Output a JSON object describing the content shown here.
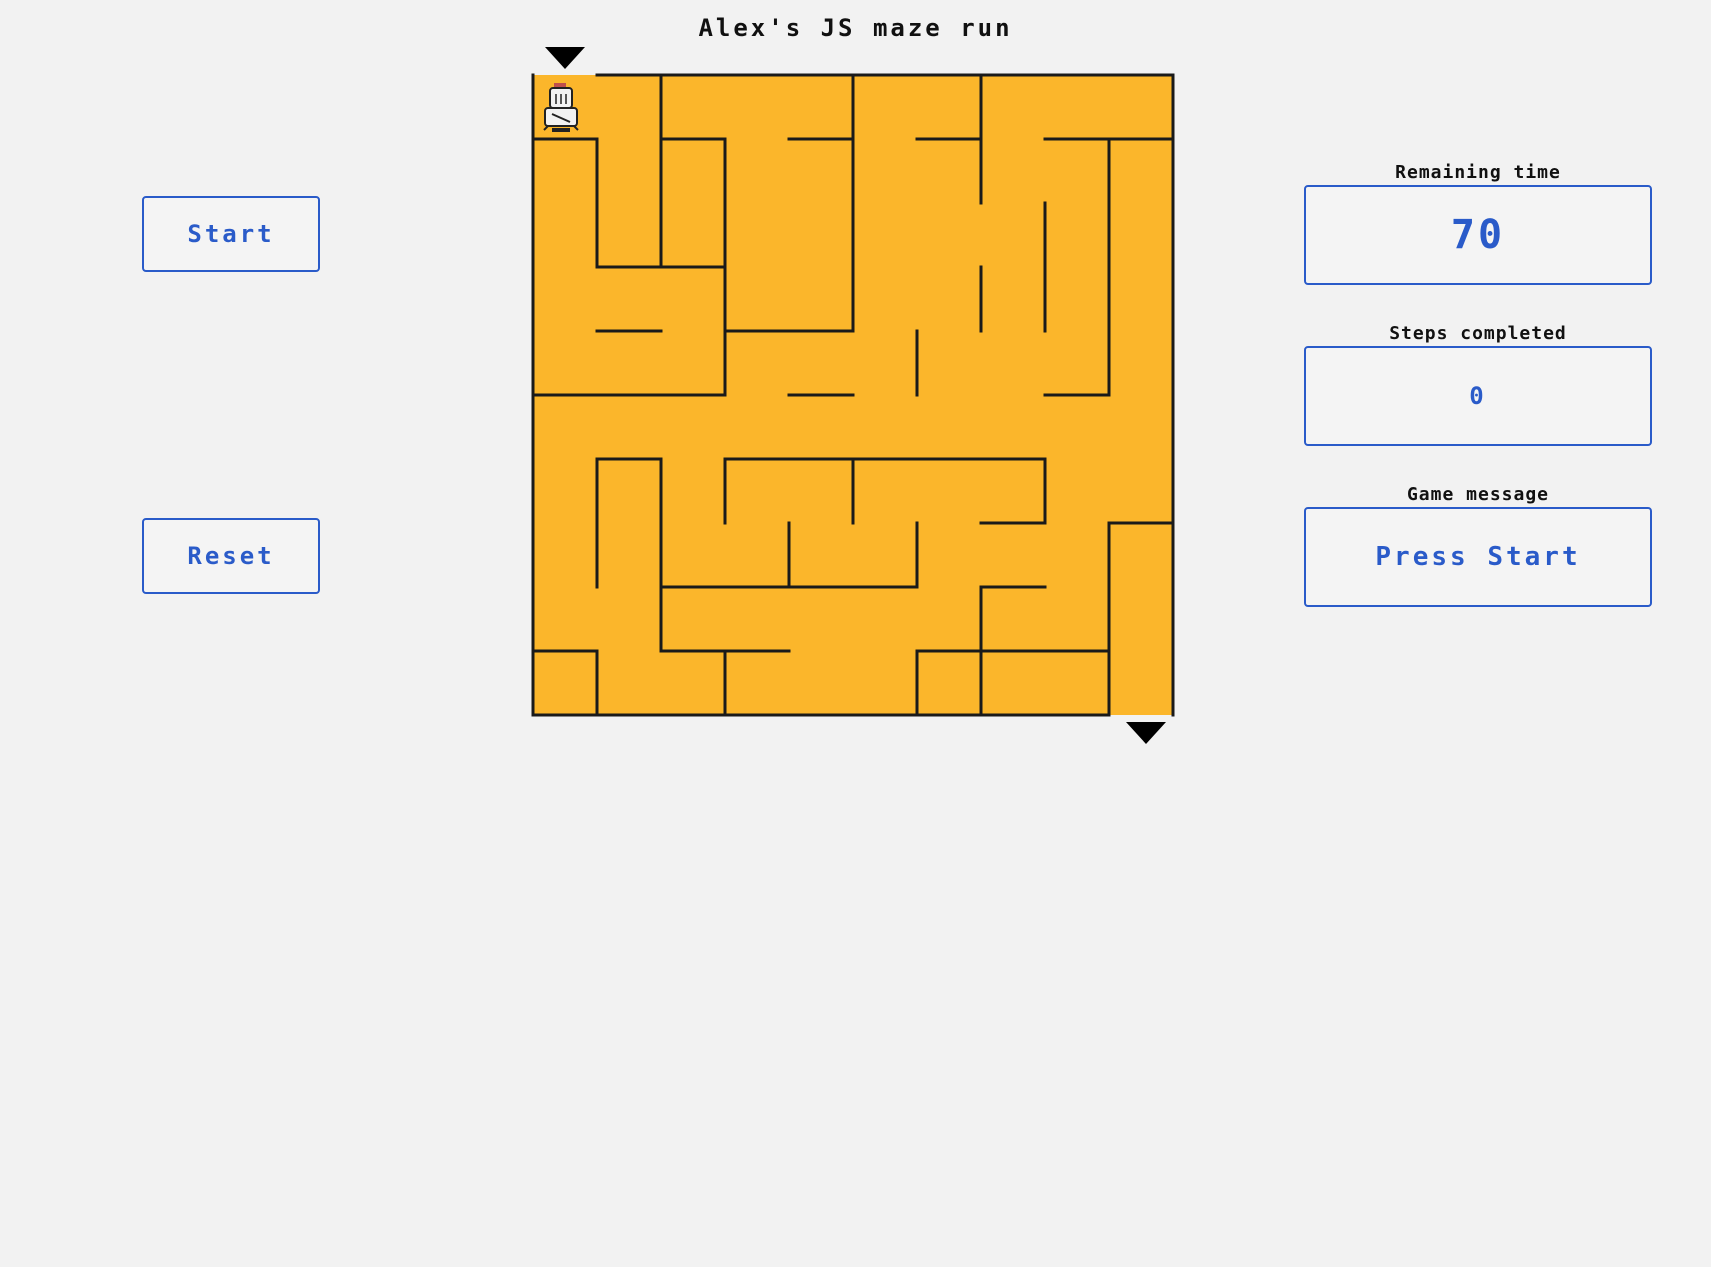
{
  "title": "Alex's JS maze run",
  "controls": {
    "start_label": "Start",
    "reset_label": "Reset"
  },
  "stats": {
    "remaining_time_label": "Remaining time",
    "remaining_time_value": "70",
    "steps_label": "Steps completed",
    "steps_value": "0",
    "message_label": "Game message",
    "message_value": "Press Start"
  },
  "maze": {
    "rows": 10,
    "cols": 10,
    "entrance_cell": [
      0,
      0
    ],
    "exit_cell": [
      9,
      9
    ],
    "player_cell": [
      0,
      0
    ],
    "horizontal_walls": [
      [
        0,
        0
      ],
      [
        2,
        1
      ],
      [
        2,
        3
      ],
      [
        4,
        1
      ],
      [
        6,
        1
      ],
      [
        8,
        1
      ],
      [
        9,
        1
      ],
      [
        1,
        3
      ],
      [
        2,
        3
      ],
      [
        1,
        4
      ],
      [
        3,
        4
      ],
      [
        4,
        4
      ],
      [
        0,
        5
      ],
      [
        1,
        5
      ],
      [
        2,
        5
      ],
      [
        4,
        5
      ],
      [
        8,
        5
      ],
      [
        1,
        6
      ],
      [
        3,
        6
      ],
      [
        4,
        6
      ],
      [
        5,
        6
      ],
      [
        6,
        6
      ],
      [
        7,
        6
      ],
      [
        7,
        7
      ],
      [
        9,
        7
      ],
      [
        2,
        8
      ],
      [
        3,
        8
      ],
      [
        4,
        8
      ],
      [
        5,
        8
      ],
      [
        7,
        8
      ],
      [
        0,
        9
      ],
      [
        2,
        9
      ],
      [
        3,
        9
      ],
      [
        6,
        9
      ],
      [
        7,
        9
      ],
      [
        8,
        9
      ],
      [
        1,
        10
      ],
      [
        2,
        10
      ]
    ],
    "vertical_walls": [
      [
        2,
        0
      ],
      [
        5,
        0
      ],
      [
        7,
        0
      ],
      [
        1,
        1
      ],
      [
        2,
        1
      ],
      [
        3,
        1
      ],
      [
        5,
        1
      ],
      [
        7,
        1
      ],
      [
        9,
        1
      ],
      [
        1,
        2
      ],
      [
        2,
        2
      ],
      [
        3,
        2
      ],
      [
        5,
        2
      ],
      [
        8,
        2
      ],
      [
        9,
        2
      ],
      [
        3,
        3
      ],
      [
        5,
        3
      ],
      [
        7,
        3
      ],
      [
        8,
        3
      ],
      [
        9,
        3
      ],
      [
        3,
        4
      ],
      [
        6,
        4
      ],
      [
        9,
        4
      ],
      [
        1,
        6
      ],
      [
        2,
        6
      ],
      [
        3,
        6
      ],
      [
        5,
        6
      ],
      [
        8,
        6
      ],
      [
        1,
        7
      ],
      [
        2,
        7
      ],
      [
        4,
        7
      ],
      [
        6,
        7
      ],
      [
        9,
        7
      ],
      [
        2,
        8
      ],
      [
        7,
        8
      ],
      [
        9,
        8
      ],
      [
        1,
        9
      ],
      [
        3,
        9
      ],
      [
        6,
        9
      ],
      [
        7,
        9
      ],
      [
        9,
        9
      ],
      [
        4,
        10
      ],
      [
        6,
        10
      ],
      [
        8,
        10
      ],
      [
        1,
        11
      ],
      [
        5,
        11
      ],
      [
        7,
        11
      ],
      [
        9,
        11
      ]
    ],
    "colors": {
      "floor": "#fbb62b",
      "wall": "#1a1a1a",
      "marker": "#000000"
    },
    "player_icon": "knight-icon"
  },
  "colors": {
    "accent": "#2a5bc9",
    "background": "#f2f2f2"
  }
}
